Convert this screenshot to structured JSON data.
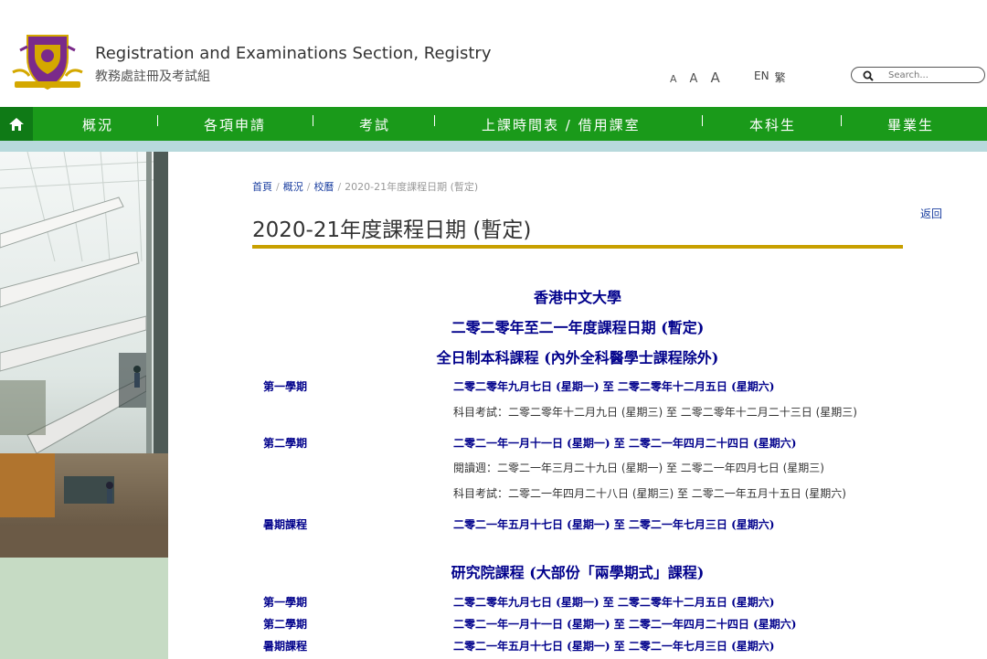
{
  "header": {
    "title_en": "Registration and Examinations Section, Registry",
    "title_zh": "教務處註冊及考試組",
    "logo_icon": "university-crest-logo",
    "font_sizes": [
      "A",
      "A",
      "A"
    ],
    "lang": [
      "EN",
      "繁"
    ],
    "search_placeholder": "Search..."
  },
  "colors": {
    "nav_green": "#1a9a1a",
    "nav_home_green": "#0f7a16",
    "nav_band": "#b7d9dc",
    "gold_rule": "#c8a000",
    "heading_blue": "#00008b",
    "link_blue": "#1b3fa0"
  },
  "nav": {
    "home_icon": "home-icon",
    "items": [
      "概況",
      "各項申請",
      "考試",
      "上課時間表 / 借用課室",
      "本科生",
      "畢業生"
    ]
  },
  "breadcrumb": [
    "首頁",
    "概況",
    "校曆",
    "2020-21年度課程日期 (暫定)"
  ],
  "back": "返回",
  "page_title": "2020-21年度課程日期 (暫定)",
  "content": {
    "heading1": "香港中文大學",
    "heading2": "二零二零年至二一年度課程日期 (暫定)",
    "heading3": "全日制本科課程 (內外全科醫學士課程除外)",
    "ug": [
      {
        "label": "第一學期",
        "main": "二零二零年九月七日 (星期一) 至 二零二零年十二月五日 (星期六)",
        "subs": [
          "科目考試：二零二零年十二月九日 (星期三) 至 二零二零年十二月二十三日 (星期三)"
        ]
      },
      {
        "label": "第二學期",
        "main": "二零二一年一月十一日 (星期一) 至 二零二一年四月二十四日 (星期六)",
        "subs": [
          "閱讀週：二零二一年三月二十九日 (星期一) 至 二零二一年四月七日 (星期三)",
          "科目考試：二零二一年四月二十八日 (星期三) 至 二零二一年五月十五日 (星期六)"
        ]
      },
      {
        "label": "暑期課程",
        "main": "二零二一年五月十七日 (星期一) 至 二零二一年七月三日 (星期六)",
        "subs": []
      }
    ],
    "heading4": "研究院課程 (大部份「兩學期式」課程)",
    "pg": [
      {
        "label": "第一學期",
        "main": "二零二零年九月七日 (星期一) 至 二零二零年十二月五日 (星期六)"
      },
      {
        "label": "第二學期",
        "main": "二零二一年一月十一日 (星期一) 至 二零二一年四月二十四日 (星期六)"
      },
      {
        "label": "暑期課程",
        "main": "二零二一年五月十七日 (星期一) 至 二零二一年七月三日 (星期六)"
      }
    ]
  }
}
